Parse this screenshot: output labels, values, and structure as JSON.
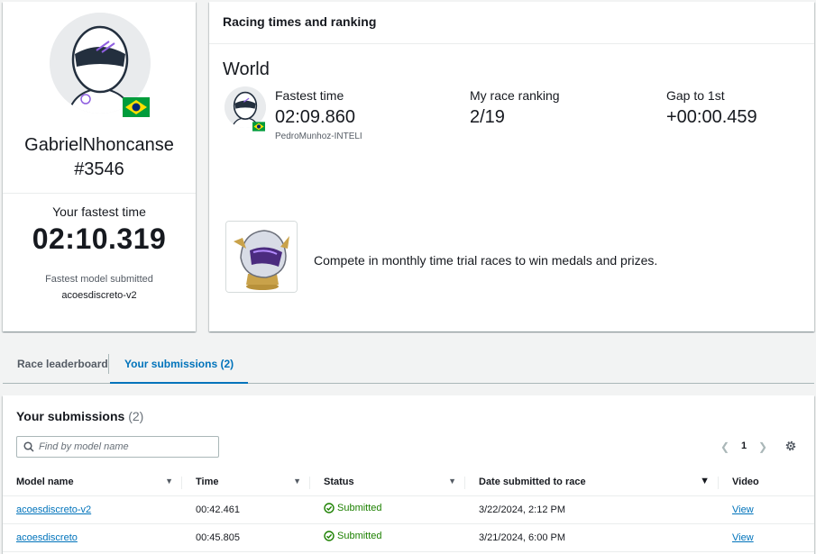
{
  "profile": {
    "username": "GabrielNhoncanse",
    "tag": "#3546",
    "fastest_label": "Your fastest time",
    "fastest_time": "02:10.319",
    "model_label": "Fastest model submitted",
    "model_name": "acoesdiscreto-v2"
  },
  "racing": {
    "header": "Racing times and ranking",
    "region": "World",
    "stats": [
      {
        "label": "Fastest time",
        "value": "02:09.860",
        "sub": "PedroMunhoz-INTELI"
      },
      {
        "label": "My race ranking",
        "value": "2/19"
      },
      {
        "label": "Gap to 1st",
        "value": "+00:00.459"
      }
    ],
    "compete_text": "Compete in monthly time trial races to win medals and prizes."
  },
  "tabs": [
    {
      "label": "Race leaderboard",
      "active": false
    },
    {
      "label": "Your submissions (2)",
      "active": true
    }
  ],
  "submissions": {
    "title": "Your submissions",
    "count": "(2)",
    "search_placeholder": "Find by model name",
    "page": "1",
    "columns": [
      "Model name",
      "Time",
      "Status",
      "Date submitted to race",
      "Video"
    ],
    "rows": [
      {
        "model": "acoesdiscreto-v2",
        "time": "00:42.461",
        "status": "Submitted",
        "date": "3/22/2024, 2:12 PM",
        "video": "View"
      },
      {
        "model": "acoesdiscreto",
        "time": "00:45.805",
        "status": "Submitted",
        "date": "3/21/2024, 6:00 PM",
        "video": "View"
      }
    ]
  },
  "colors": {
    "link": "#0073bb",
    "success": "#1d8102",
    "background": "#f2f3f3"
  },
  "icons": {
    "avatar": "helmet-avatar-icon",
    "flag": "brazil-flag-icon",
    "search": "search-icon",
    "settings": "gear-icon",
    "status": "check-circle-icon"
  }
}
